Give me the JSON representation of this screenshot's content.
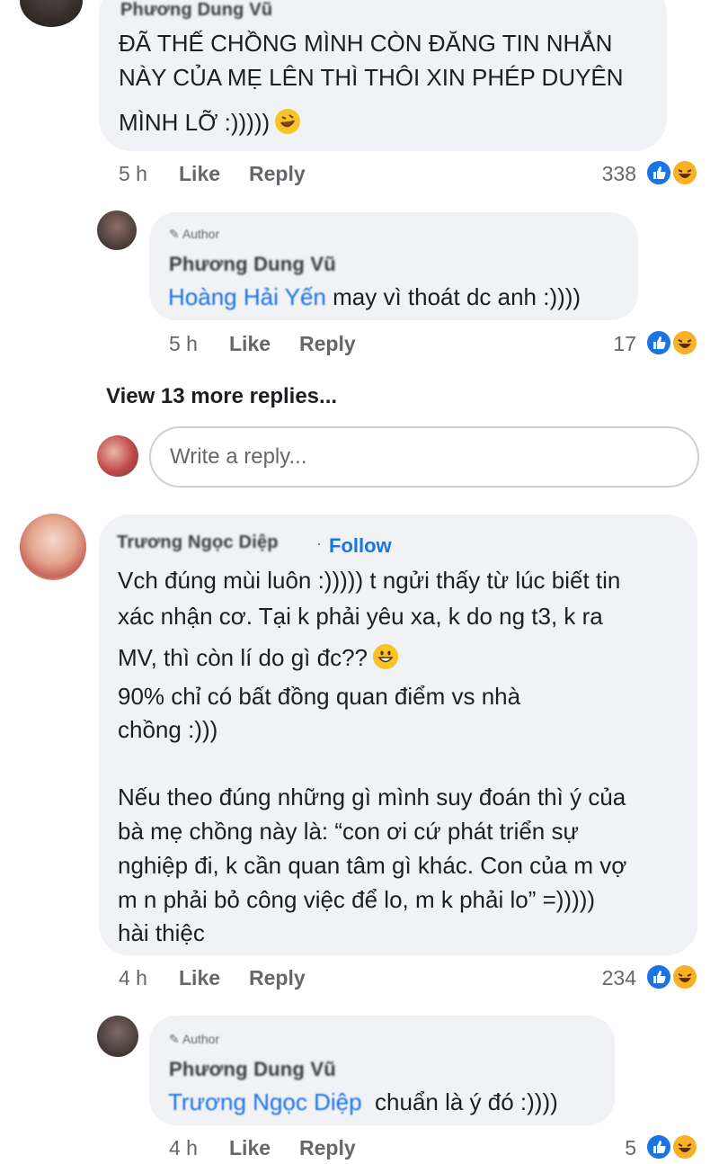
{
  "comments": [
    {
      "name": "Phương Dung Vũ",
      "text_lines": [
        "ĐÃ THẾ CHỒNG MÌNH CÒN ĐĂNG TIN NHẮN",
        "NÀY CỦA MẸ LÊN THÌ THÔI XIN PHÉP DUYÊN",
        "MÌNH LỠ :)))))"
      ],
      "time": "5 h",
      "like": "Like",
      "reply": "Reply",
      "count": "338"
    },
    {
      "badge": "Author",
      "name": "Phương Dung Vũ",
      "mention": "Hoàng Hải Yến",
      "text": "may vì thoát dc anh :))))",
      "time": "5 h",
      "like": "Like",
      "reply": "Reply",
      "count": "17"
    },
    {
      "name": "Trương Ngọc Diệp",
      "follow": "Follow",
      "text_lines": [
        "Vch đúng mùi luôn :))))) t ngửi thấy từ lúc biết tin",
        "xác nhận cơ. Tại k phải yêu xa, k do ng t3, k ra",
        "MV, thì còn lí do gì đc??",
        "90% chỉ có bất đồng quan điểm vs nhà",
        "chồng :)))",
        "",
        "Nếu theo đúng những gì mình suy đoán thì ý của",
        "bà mẹ chồng này là: “con ơi cứ phát triển sự",
        "nghiệp đi, k cần quan tâm gì khác. Con của m vợ",
        "m n phải bỏ công việc để lo, m k phải lo” =)))))",
        "hài thiệc"
      ],
      "time": "4 h",
      "like": "Like",
      "reply": "Reply",
      "count": "234"
    },
    {
      "badge": "Author",
      "name": "Phương Dung Vũ",
      "mention": "Trương Ngọc Diệp",
      "text": "chuẩn là ý đó :))))",
      "time": "4 h",
      "like": "Like",
      "reply": "Reply",
      "count": "5"
    }
  ],
  "view_more": "View 13 more replies...",
  "reply_placeholder": "Write a reply...",
  "colors": {
    "like_blue": "#1b74e4",
    "haha_yellow": "#f7b125",
    "bubble": "#f0f2f5"
  }
}
